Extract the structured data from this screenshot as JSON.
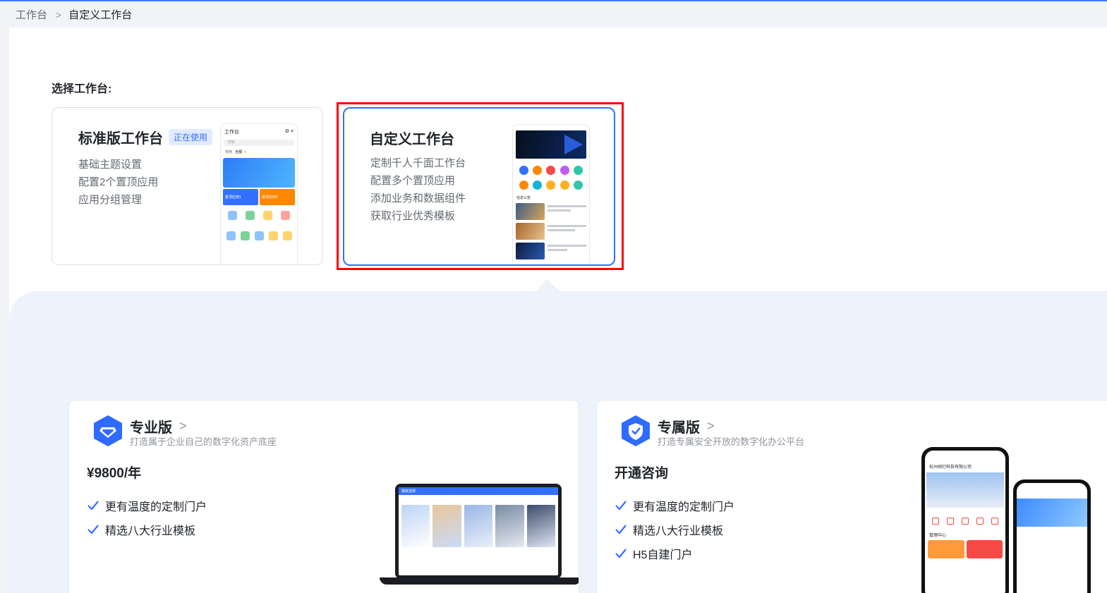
{
  "breadcrumb": {
    "root": "工作台",
    "current": "自定义工作台"
  },
  "section_label": "选择工作台:",
  "standard": {
    "title": "标准版工作台",
    "badge": "正在使用",
    "features": [
      "基础主题设置",
      "配置2个置顶应用",
      "应用分组管理"
    ],
    "preview": {
      "header": "工作台",
      "search": "搜索",
      "tabs": [
        "常用",
        "全部"
      ],
      "tile_a": "置顶应用1",
      "tile_b": "置顶应用2"
    }
  },
  "custom": {
    "title": "自定义工作台",
    "features": [
      "定制千人千面工作台",
      "配置多个置顶应用",
      "添加业务和数据组件",
      "获取行业优秀模板"
    ],
    "preview": {
      "section": "信息公告"
    }
  },
  "plans": {
    "pro": {
      "name": "专业版",
      "desc": "打造属于企业自己的数字化资产底座",
      "price": "¥9800/年",
      "features": [
        "更有温度的定制门户",
        "精选八大行业模板"
      ],
      "preview_title": "模板选择"
    },
    "exclusive": {
      "name": "专属版",
      "desc": "打造专属安全开放的数字化办公平台",
      "price": "开通咨询",
      "features": [
        "更有温度的定制门户",
        "精选八大行业模板",
        "H5自建门户"
      ],
      "phone_company": "杭州闻钉科技有限公司",
      "phone_section": "管理中心"
    }
  },
  "colors": {
    "accent": "#3370ff",
    "highlight": "#ff0000"
  }
}
